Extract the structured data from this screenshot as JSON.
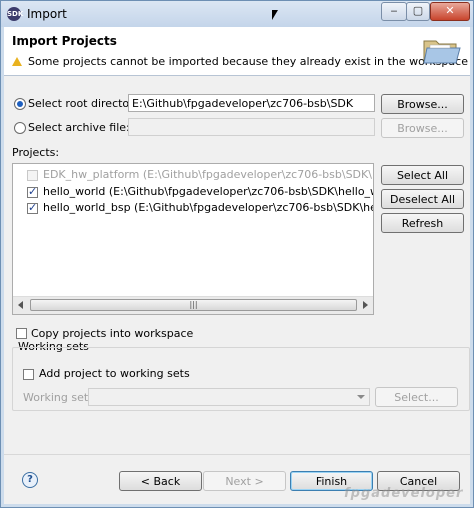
{
  "window": {
    "title": "Import",
    "minimize": "‒",
    "restore": "▢",
    "close": "✕"
  },
  "header": {
    "title": "Import Projects",
    "warning": "Some projects cannot be imported because they already exist in the workspace"
  },
  "root_dir": {
    "label": "Select root directory:",
    "value": "E:\\Github\\fpgadeveloper\\zc706-bsb\\SDK",
    "browse": "Browse..."
  },
  "archive": {
    "label": "Select archive file:",
    "value": "",
    "browse": "Browse..."
  },
  "projects": {
    "label": "Projects:",
    "items": [
      {
        "text": "EDK_hw_platform (E:\\Github\\fpgadeveloper\\zc706-bsb\\SDK\\EDK_hw_platform)",
        "checked": false,
        "enabled": false
      },
      {
        "text": "hello_world (E:\\Github\\fpgadeveloper\\zc706-bsb\\SDK\\hello_world)",
        "checked": true,
        "enabled": true
      },
      {
        "text": "hello_world_bsp (E:\\Github\\fpgadeveloper\\zc706-bsb\\SDK\\hello_world_bsp)",
        "checked": true,
        "enabled": true
      }
    ],
    "select_all": "Select All",
    "deselect_all": "Deselect All",
    "refresh": "Refresh"
  },
  "copy_projects": {
    "label": "Copy projects into workspace",
    "checked": false
  },
  "working_sets": {
    "group": "Working sets",
    "add_label": "Add project to working sets",
    "sets_label": "Working sets:",
    "select": "Select..."
  },
  "footer": {
    "back": "< Back",
    "next": "Next >",
    "finish": "Finish",
    "cancel": "Cancel"
  },
  "watermark": "fpgadeveloper"
}
